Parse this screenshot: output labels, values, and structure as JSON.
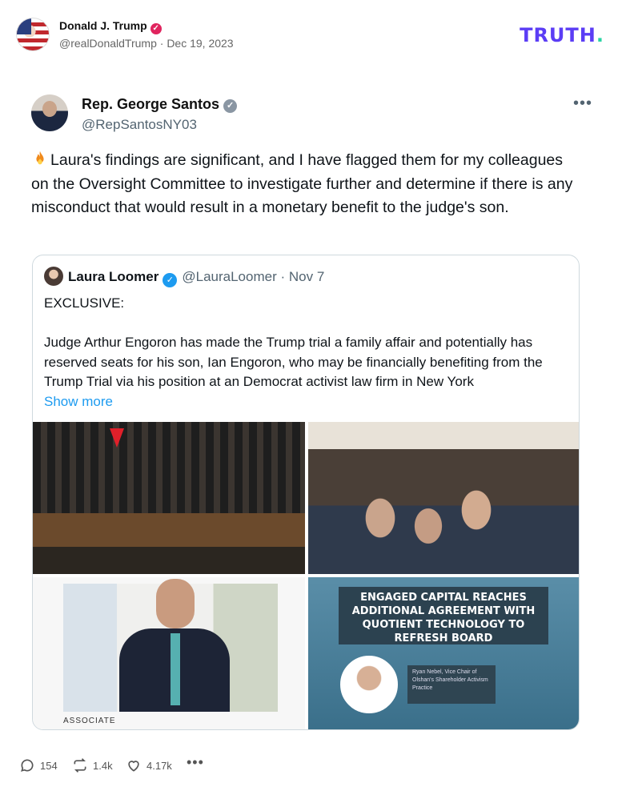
{
  "post": {
    "author_name": "Donald J. Trump",
    "author_handle": "@realDonaldTrump",
    "date": "Dec 19, 2023",
    "brand": "TRUTH",
    "brand_dot": "."
  },
  "embedded": {
    "name": "Rep. George Santos",
    "handle": "@RepSantosNY03",
    "more": "•••",
    "text": "Laura's findings are significant, and I have flagged them for my colleagues on the Oversight Committee to investigate further and determine if there is any misconduct that would result in a monetary benefit to the judge's son.",
    "text_icon": "fire-icon"
  },
  "quote": {
    "name": "Laura Loomer",
    "handle": "@LauraLoomer",
    "date": "Nov 7",
    "label": "EXCLUSIVE:",
    "body": "Judge Arthur Engoron has made the Trump trial a family affair and potentially has reserved seats for his son, Ian Engoron, who may be financially benefiting from the Trump Trial via his position at an Democrat activist law firm in New York",
    "show_more": "Show more"
  },
  "images": {
    "img3_caption": "ASSOCIATE",
    "img4_banner": "ENGAGED CAPITAL REACHES ADDITIONAL AGREEMENT WITH QUOTIENT TECHNOLOGY TO REFRESH BOARD",
    "img4_caption": "Ryan Nebel, Vice Chair of Olshan's Shareholder Activism Practice"
  },
  "actions": {
    "replies": "154",
    "reposts": "1.4k",
    "likes": "4.17k",
    "more": "•••"
  },
  "colors": {
    "brand": "#5b3df5",
    "brand_dot": "#2ad4a4",
    "link": "#1d9bf0",
    "verified_blue": "#1d9bf0"
  }
}
